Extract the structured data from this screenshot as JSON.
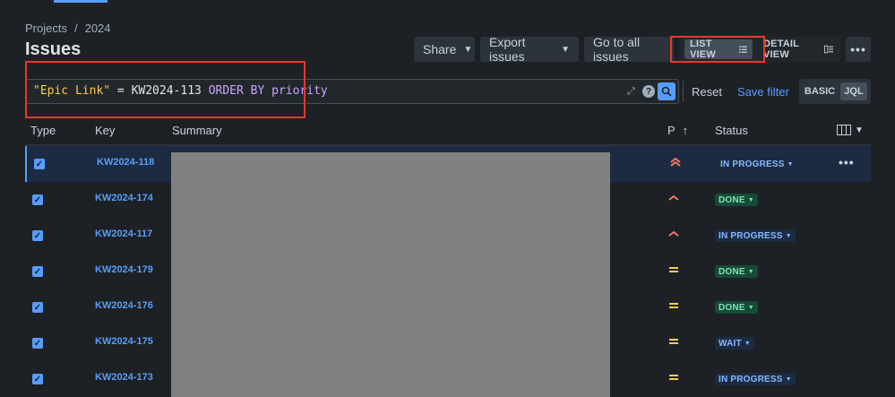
{
  "breadcrumb": {
    "root": "Projects",
    "separator": "/",
    "current": "2024"
  },
  "page_title": "Issues",
  "toolbar": {
    "share_label": "Share",
    "export_label": "Export issues",
    "go_all_label": "Go to all issues",
    "list_view_label": "LIST VIEW",
    "detail_view_label": "DETAIL VIEW",
    "more_label": "•••"
  },
  "search": {
    "field": "\"Epic Link\"",
    "operator": "=",
    "value": "KW2024-113",
    "order_kw": "ORDER BY",
    "order_field": "priority",
    "expand_icon": "expand-icon",
    "help": "?",
    "reset_label": "Reset",
    "save_filter_label": "Save filter",
    "basic_label": "BASIC",
    "jql_label": "JQL"
  },
  "table": {
    "headers": {
      "type": "Type",
      "key": "Key",
      "summary": "Summary",
      "priority": "P",
      "status": "Status"
    },
    "rows": [
      {
        "key": "KW2024-118",
        "priority": "highest",
        "status": "IN PROGRESS",
        "selected": true
      },
      {
        "key": "KW2024-174",
        "priority": "high",
        "status": "DONE"
      },
      {
        "key": "KW2024-117",
        "priority": "high",
        "status": "IN PROGRESS"
      },
      {
        "key": "KW2024-179",
        "priority": "medium",
        "status": "DONE"
      },
      {
        "key": "KW2024-176",
        "priority": "medium",
        "status": "DONE"
      },
      {
        "key": "KW2024-175",
        "priority": "medium",
        "status": "WAIT"
      },
      {
        "key": "KW2024-173",
        "priority": "medium",
        "status": "IN PROGRESS"
      }
    ]
  },
  "colors": {
    "background": "#1d2125",
    "accent": "#579dff",
    "highlight_box": "#e5392b",
    "priority_highest": "#f87462",
    "priority_high": "#f87462",
    "priority_medium": "#f5cd47"
  }
}
